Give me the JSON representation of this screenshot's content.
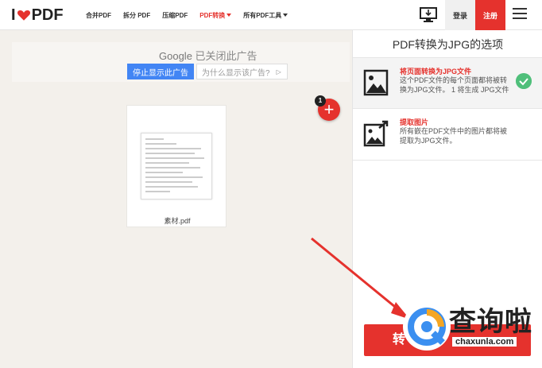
{
  "header": {
    "logo_left": "I",
    "logo_right": "PDF",
    "nav": [
      {
        "label": "合并PDF",
        "active": false,
        "caret": false
      },
      {
        "label": "拆分 PDF",
        "active": false,
        "caret": false
      },
      {
        "label": "压缩PDF",
        "active": false,
        "caret": false
      },
      {
        "label": "PDF转换",
        "active": true,
        "caret": true
      },
      {
        "label": "所有PDF工具",
        "active": false,
        "caret": true
      }
    ],
    "login_label": "登录",
    "signup_label": "注册"
  },
  "ad": {
    "brand": "Google",
    "closed_text": "已关闭此广告",
    "stop_label": "停止显示此广告",
    "why_label": "为什么显示该广告?"
  },
  "file": {
    "name": "素材.pdf",
    "count_badge": "1"
  },
  "panel": {
    "title": "PDF转换为JPG的选项",
    "options": [
      {
        "title": "将页面转换为JPG文件",
        "desc": "这个PDF文件的每个页面都将被转换为JPG文件。 1 将生成 JPG文件",
        "selected": true
      },
      {
        "title": "提取图片",
        "desc": "所有嵌在PDF文件中的图片都将被提取为JPG文件。",
        "selected": false
      }
    ],
    "convert_label": "转"
  },
  "watermark": {
    "text": "查询啦",
    "url": "chaxunla.com"
  },
  "colors": {
    "brand_red": "#e5322d",
    "google_blue": "#4285f4",
    "check_green": "#4fbf7a"
  }
}
